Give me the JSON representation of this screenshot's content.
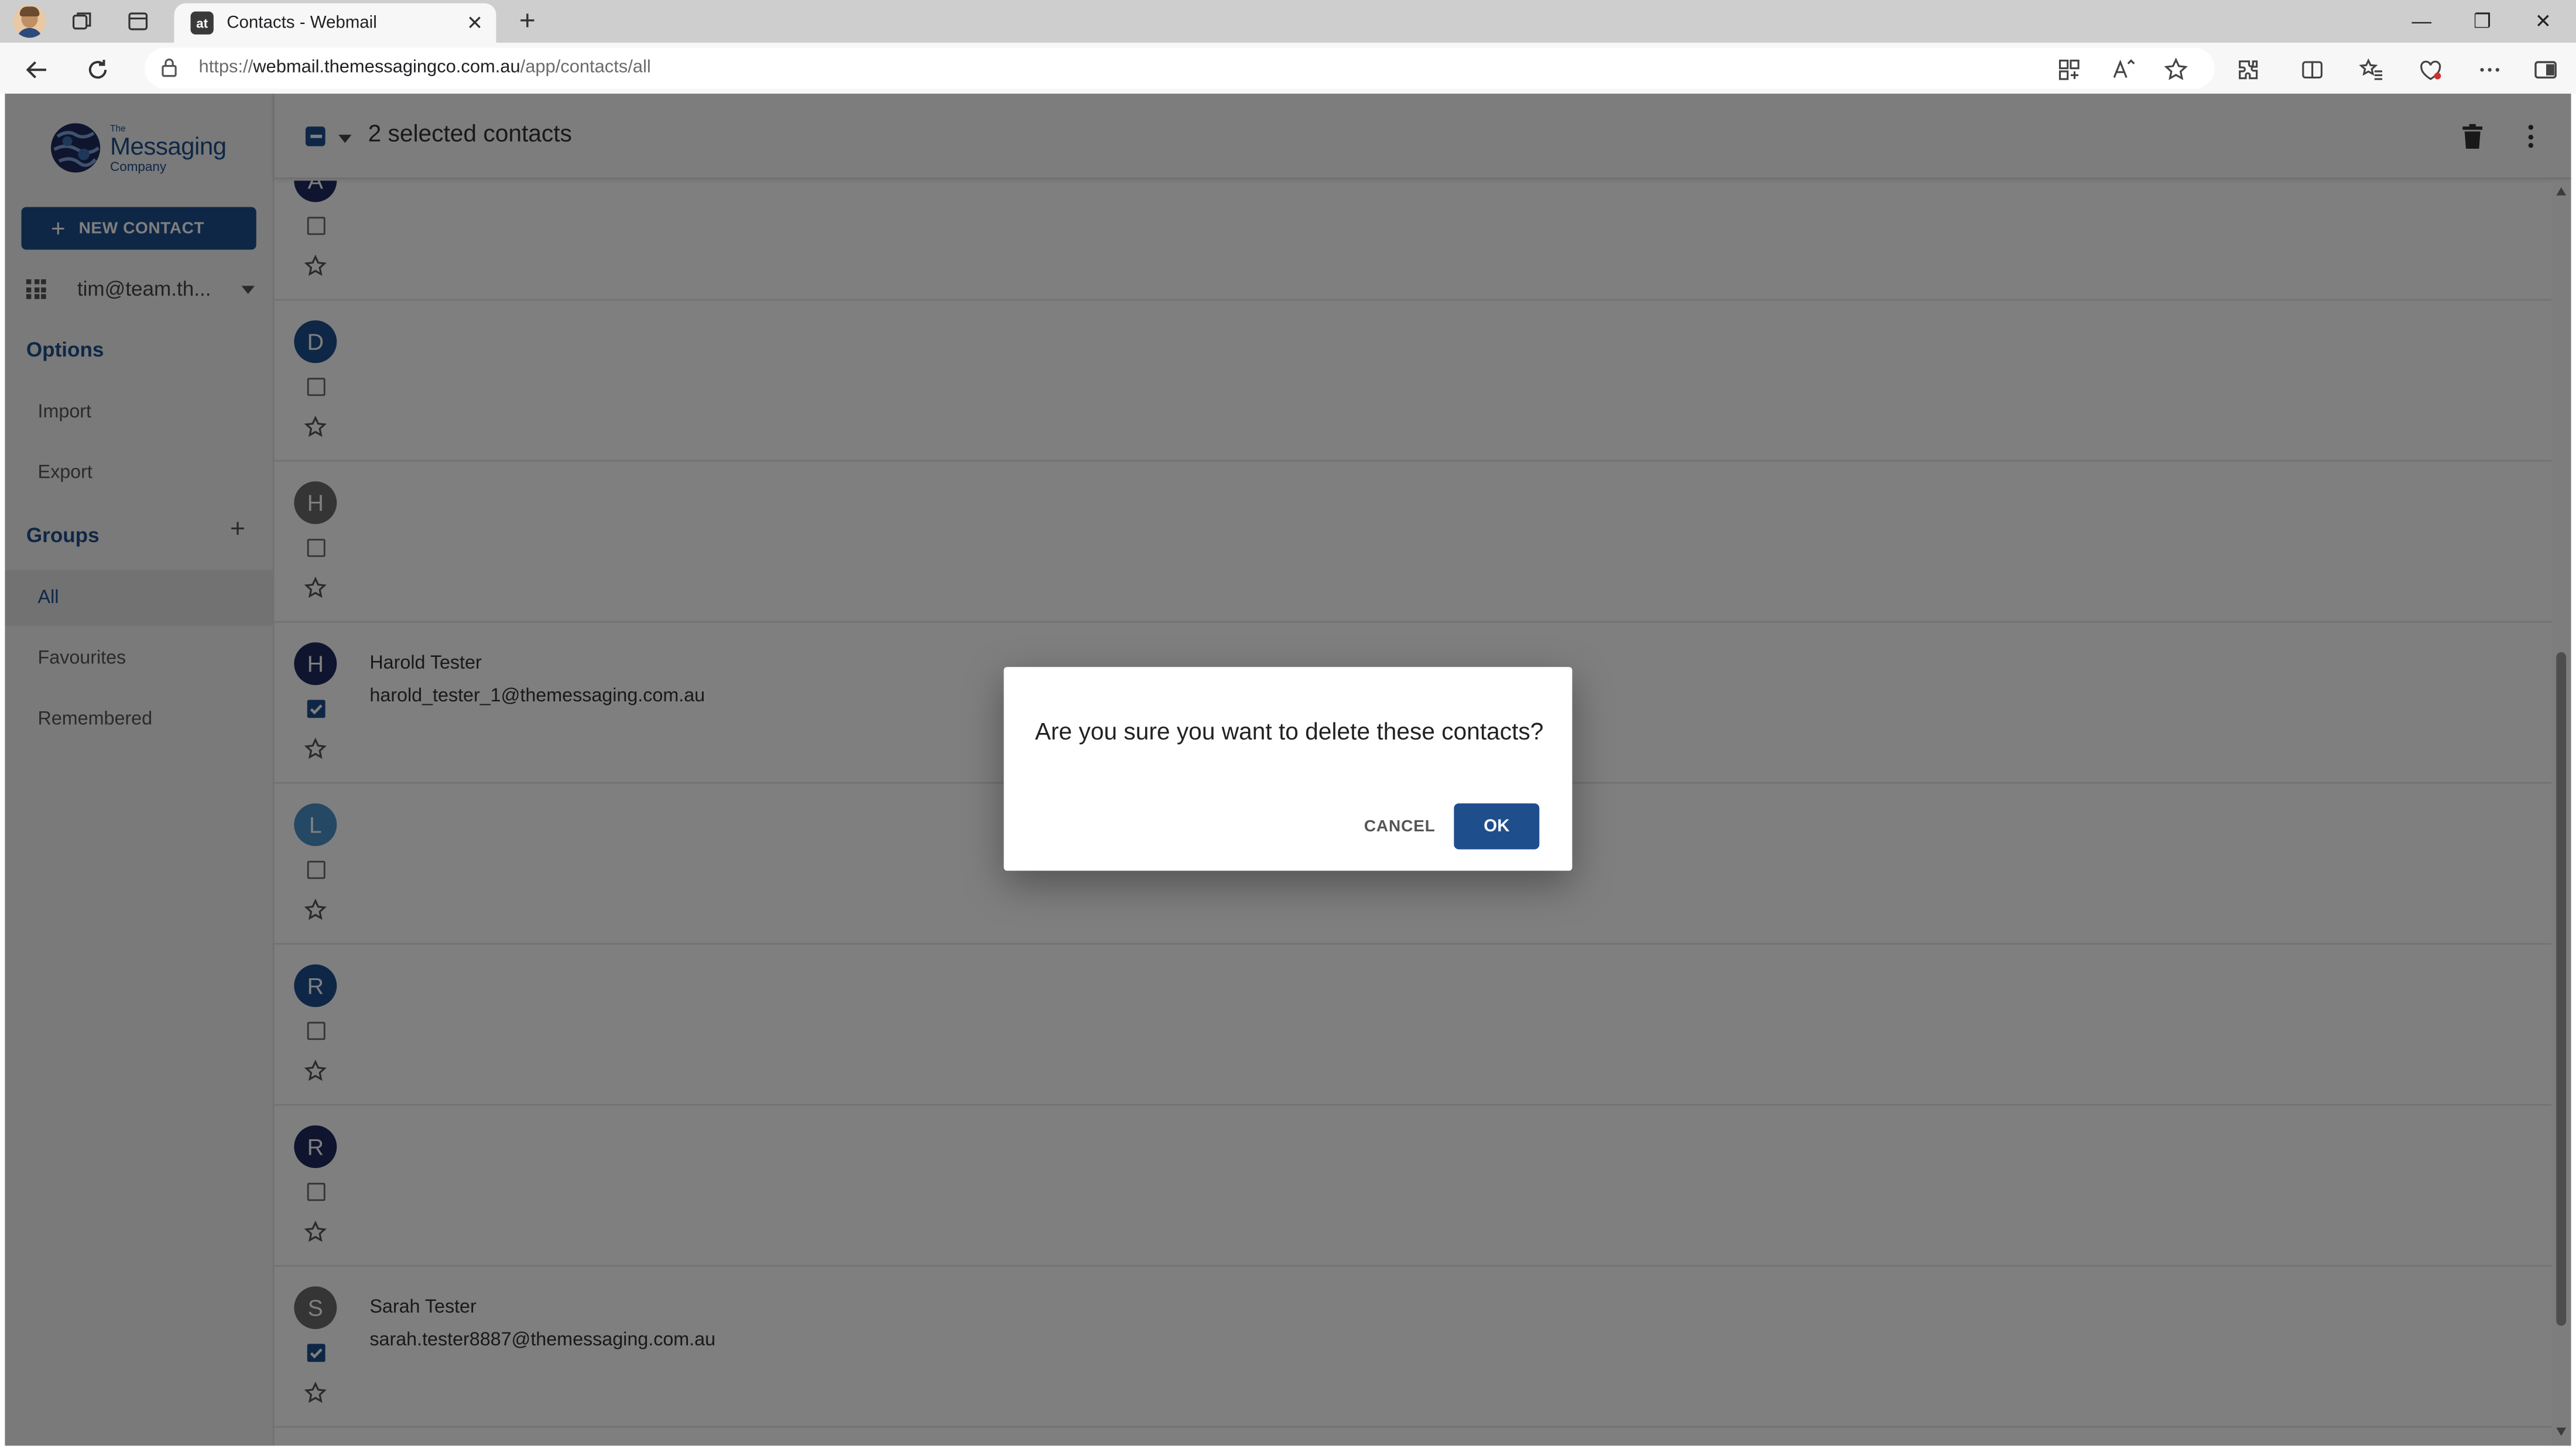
{
  "browser": {
    "tab_title": "Contacts - Webmail",
    "tab_favicon": "at",
    "url_scheme": "https://",
    "url_host": "webmail.themessagingco.com.au",
    "url_path": "/app/contacts/all",
    "close_symbol": "✕",
    "newtab_symbol": "+",
    "minimize_symbol": "—",
    "restore_symbol": "❐",
    "window_close_symbol": "✕"
  },
  "sidebar": {
    "logo": {
      "the": "The",
      "messaging": "Messaging",
      "company": "Company"
    },
    "new_contact_label": "NEW CONTACT",
    "new_contact_icon": "+",
    "account": "tim@team.th...",
    "options_heading": "Options",
    "options": [
      {
        "label": "Import"
      },
      {
        "label": "Export"
      }
    ],
    "groups_heading": "Groups",
    "groups_add_icon": "+",
    "groups": [
      {
        "label": "All",
        "active": true
      },
      {
        "label": "Favourites",
        "active": false
      },
      {
        "label": "Remembered",
        "active": false
      }
    ]
  },
  "topbar": {
    "selected_label": "2 selected contacts"
  },
  "contacts": [
    {
      "initial": "A",
      "color": "#1e2b5e",
      "name": "",
      "email": "",
      "checked": false
    },
    {
      "initial": "D",
      "color": "#1f4e8c",
      "name": "",
      "email": "",
      "checked": false
    },
    {
      "initial": "H",
      "color": "#6b6b6b",
      "name": "",
      "email": "",
      "checked": false
    },
    {
      "initial": "H",
      "color": "#1e2b5e",
      "name": "Harold Tester",
      "email": "harold_tester_1@themessaging.com.au",
      "checked": true
    },
    {
      "initial": "L",
      "color": "#4a90c8",
      "name": "",
      "email": "",
      "checked": false
    },
    {
      "initial": "R",
      "color": "#1f4e8c",
      "name": "",
      "email": "",
      "checked": false
    },
    {
      "initial": "R",
      "color": "#1e2b5e",
      "name": "",
      "email": "",
      "checked": false
    },
    {
      "initial": "S",
      "color": "#6b6b6b",
      "name": "Sarah Tester",
      "email": "sarah.tester8887@themessaging.com.au",
      "checked": true
    }
  ],
  "dialog": {
    "message": "Are you sure you want to delete these contacts?",
    "cancel_label": "CANCEL",
    "ok_label": "OK"
  },
  "colors": {
    "brand": "#1f4e8c",
    "overlay": "rgba(0,0,0,0.5)"
  }
}
